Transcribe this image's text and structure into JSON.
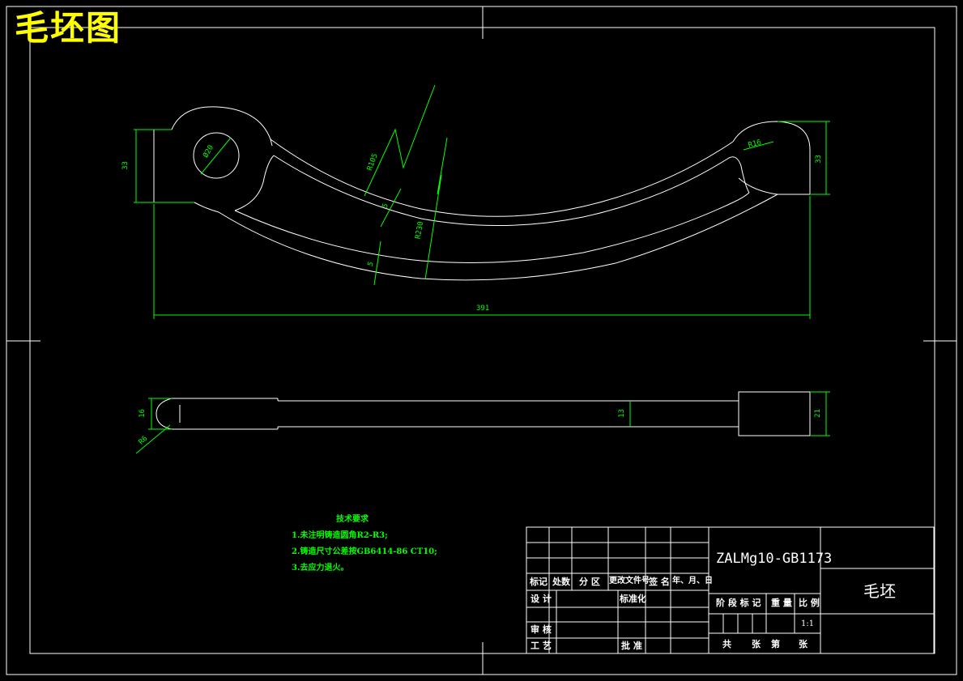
{
  "drawing_title": "毛坯图",
  "dimensions": {
    "left_height": "33",
    "hole_diameter": "Ø20",
    "outer_radius": "R105",
    "inner_width": "5",
    "lower_width": "5",
    "arc_radius": "R230",
    "right_radius": "R16",
    "right_height": "33",
    "overall_length": "391",
    "bottom_left_height": "16",
    "bottom_left_radius": "R6",
    "bottom_mid_height": "13",
    "bottom_right_height": "21"
  },
  "technical_requirements": {
    "heading": "技术要求",
    "items": [
      "1.未注明铸造圆角R2-R3;",
      "2.铸造尺寸公差按GB6414-86 CT10;",
      "3.去应力退火。"
    ]
  },
  "title_block": {
    "material": "ZALMg10-GB1173",
    "part_name": "毛坯",
    "scale_value": "1:1",
    "rev_headers": [
      "标记",
      "处数",
      "分 区",
      "更改文件号",
      "签 名",
      "年、月、日"
    ],
    "design": "设 计",
    "standardize": "标准化",
    "review": "审 核",
    "process": "工 艺",
    "approve": "批 准",
    "stage_mark": "阶 段 标 记",
    "weight": "重 量",
    "scale": "比 例",
    "total": "共",
    "sheets": "张",
    "page": "第",
    "sheet_word": "张"
  }
}
